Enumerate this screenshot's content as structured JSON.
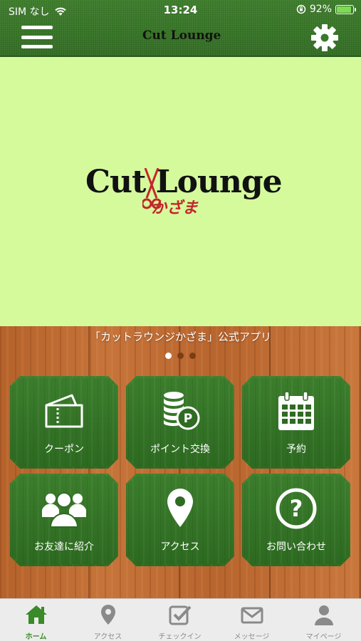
{
  "status_bar": {
    "carrier": "SIM なし",
    "time": "13:24",
    "battery": "92%",
    "battery_level": 0.92
  },
  "header": {
    "logo_text": "Cut Lounge",
    "menu_icon": "hamburger-menu-icon",
    "settings_icon": "gear-icon"
  },
  "hero": {
    "logo_main": "Cut Lounge",
    "logo_sub": "かざま"
  },
  "banner": {
    "text": "「カットラウンジかざま」公式アプリ",
    "pages": 3,
    "current_page": 1
  },
  "tiles": [
    {
      "label": "クーポン",
      "icon": "ticket-icon"
    },
    {
      "label": "ポイント交換",
      "icon": "coins-point-icon"
    },
    {
      "label": "予約",
      "icon": "calendar-icon"
    },
    {
      "label": "お友達に紹介",
      "icon": "group-users-icon"
    },
    {
      "label": "アクセス",
      "icon": "map-pin-icon"
    },
    {
      "label": "お問い合わせ",
      "icon": "question-circle-icon"
    }
  ],
  "tabbar": {
    "items": [
      {
        "label": "ホーム",
        "icon": "home-icon",
        "active": true
      },
      {
        "label": "アクセス",
        "icon": "map-pin-icon",
        "active": false
      },
      {
        "label": "チェックイン",
        "icon": "checkbox-icon",
        "active": false
      },
      {
        "label": "メッセージ",
        "icon": "envelope-icon",
        "active": false
      },
      {
        "label": "マイページ",
        "icon": "user-icon",
        "active": false
      }
    ]
  },
  "colors": {
    "header_green": "#3e7d2c",
    "hero_background": "#d5fa9c",
    "tab_active": "#3a8a2a",
    "tab_inactive": "#8a8a8a",
    "logo_accent": "#c4262b"
  }
}
